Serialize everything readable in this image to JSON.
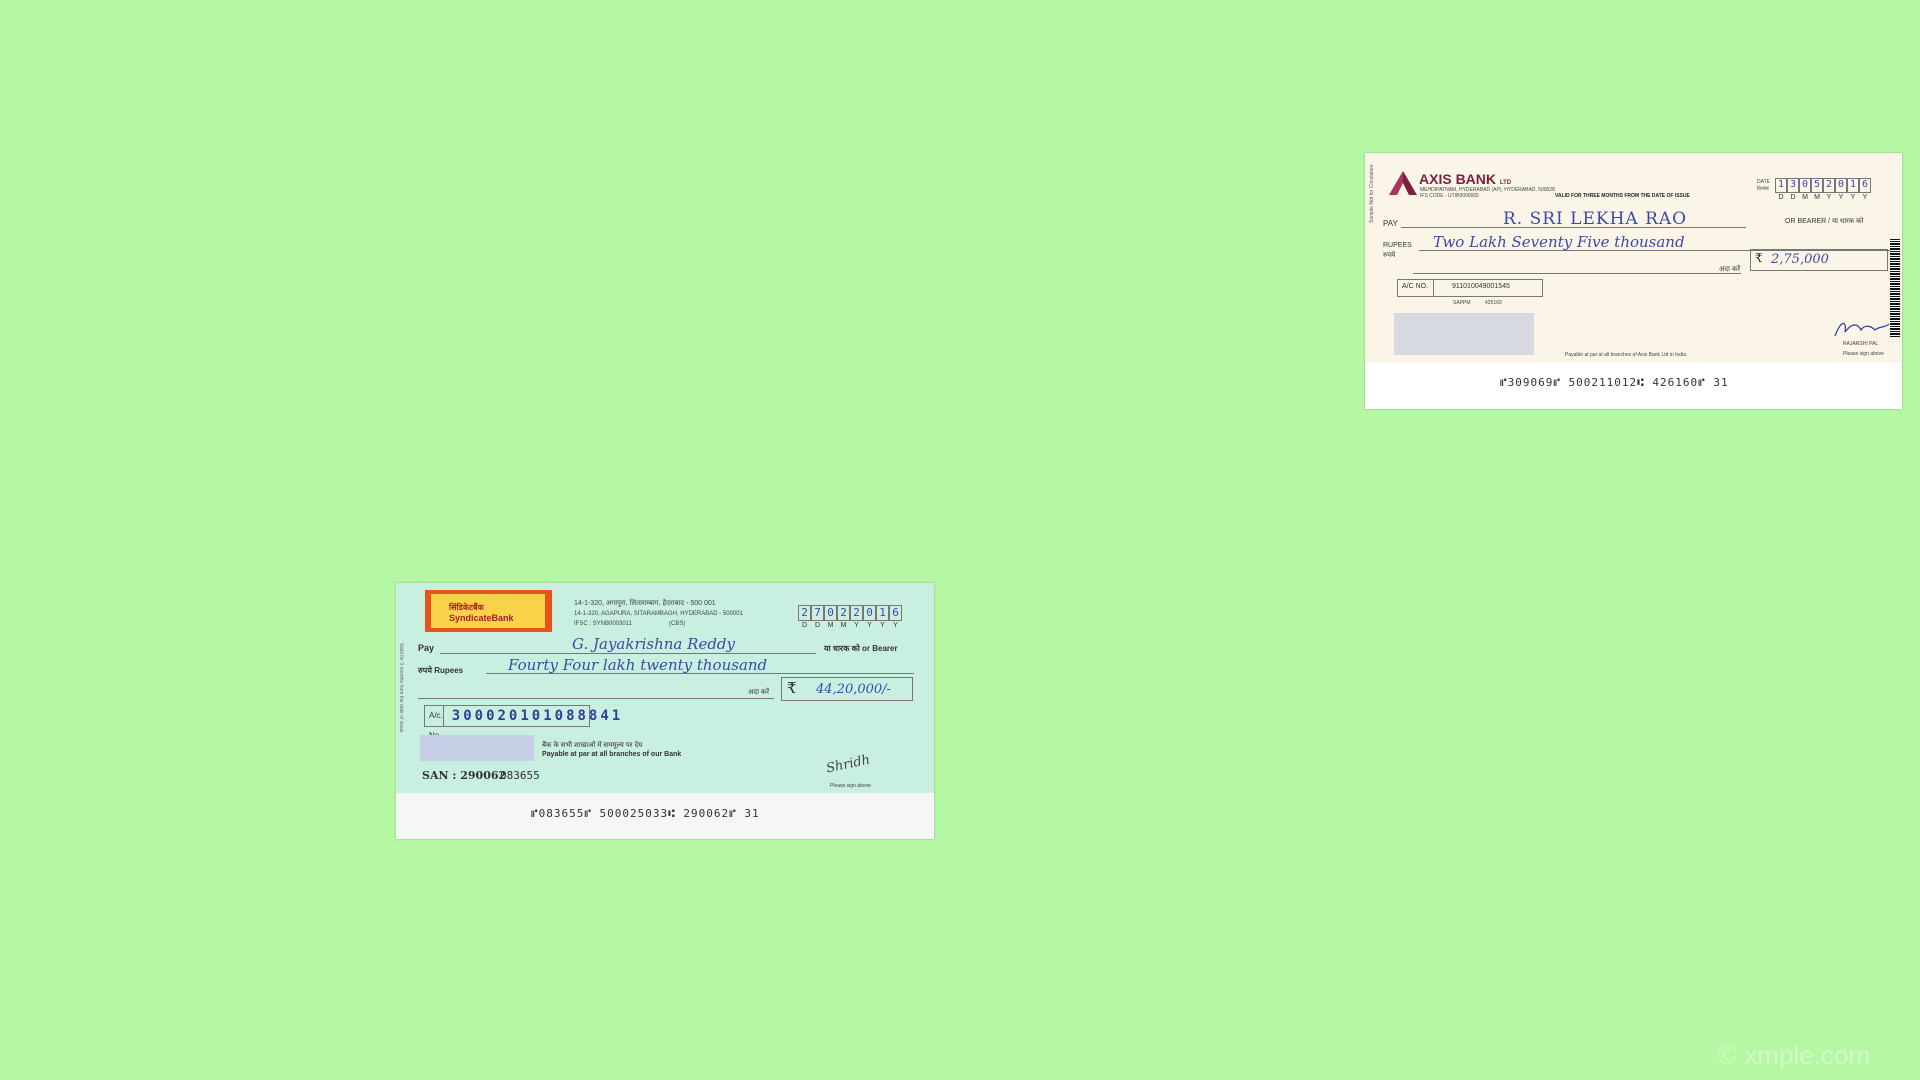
{
  "axis_cheque": {
    "bank_name": "AXIS BANK",
    "bank_suffix": "LTD",
    "branch": "MEHDIPATNAM, HYDERABAD (AP), HYDERABAD, 500028",
    "ifs": "IFS CODE - UTIB0000005",
    "validity": "VALID FOR THREE MONTHS FROM THE DATE OF ISSUE",
    "date_label": "DATE",
    "date_label_hi": "दिनांक",
    "date_digits": [
      "1",
      "3",
      "0",
      "5",
      "2",
      "0",
      "1",
      "6"
    ],
    "date_format": [
      "D",
      "D",
      "M",
      "M",
      "Y",
      "Y",
      "Y",
      "Y"
    ],
    "pay_label": "PAY",
    "payee": "R. SRI LEKHA RAO",
    "bearer_label": "OR BEARER / या धारक को",
    "rupees_label": "RUPEES",
    "rupees_label_hi": "रुपये",
    "amount_words": "Two Lakh Seventy Five thousand",
    "ada_karen": "अदा करें",
    "rupee_symbol": "₹",
    "amount_figures": "2,75,000",
    "ac_label": "A/C NO.",
    "ac_number": "911010049001545",
    "sapm_label": "SAPPM",
    "sapm_value": "425160",
    "payable_note": "Payable at par at all branches of Axis Bank Ltd in India.",
    "signatory": "RAJARSHI PAL",
    "sign_note": "Please sign above",
    "micr": "⑈309069⑈  500211012⑆  426160⑈  31",
    "side_text": "Sample Not for Circulation"
  },
  "syndicate_cheque": {
    "logo_text": "SyndicateBank",
    "logo_text_hi": "सिंडिकेटबैंक",
    "address_hi": "14-1-320, अगापुरा, सिताराम्बाग, हैदराबाद - 500 001",
    "address": "14-1-320, AGAPURA, SITARAMBAGH, HYDERABAD - 500001",
    "ifsc": "IFSC : SYNB0003011",
    "cbs": "(CBS)",
    "date_digits": [
      "2",
      "7",
      "0",
      "2",
      "2",
      "0",
      "1",
      "6"
    ],
    "date_format": [
      "D",
      "D",
      "M",
      "M",
      "Y",
      "Y",
      "Y",
      "Y"
    ],
    "pay_label": "Pay",
    "payee": "G. Jayakrishna Reddy",
    "bearer_label": "या धारक को  or Bearer",
    "rupees_label": "रुपये Rupees",
    "amount_words": "Fourty Four lakh twenty thousand",
    "ada_karen": "अदा करें",
    "rupee_symbol": "₹",
    "amount_figures": "44,20,000/-",
    "ac_label": "A/c. No.",
    "ac_number": "300020101088841",
    "branches_hi": "बैंक के सभी शाखाओं में सममूल्य पर देय",
    "branches": "Payable at par at all branches of our Bank",
    "san_label": "SAN : 290062",
    "san_value": "083655",
    "signature": "Shridh",
    "sign_note": "Please sign above",
    "micr": "⑈083655⑈  500025033⑆  290062⑈  31",
    "side_text": "Valid for 3 months from the date of issue"
  },
  "watermark": "© xmple.com",
  "colors": {
    "background": "#b5f7a3",
    "axis_brand": "#7d1e3e",
    "ink": "#3a4aa8"
  }
}
